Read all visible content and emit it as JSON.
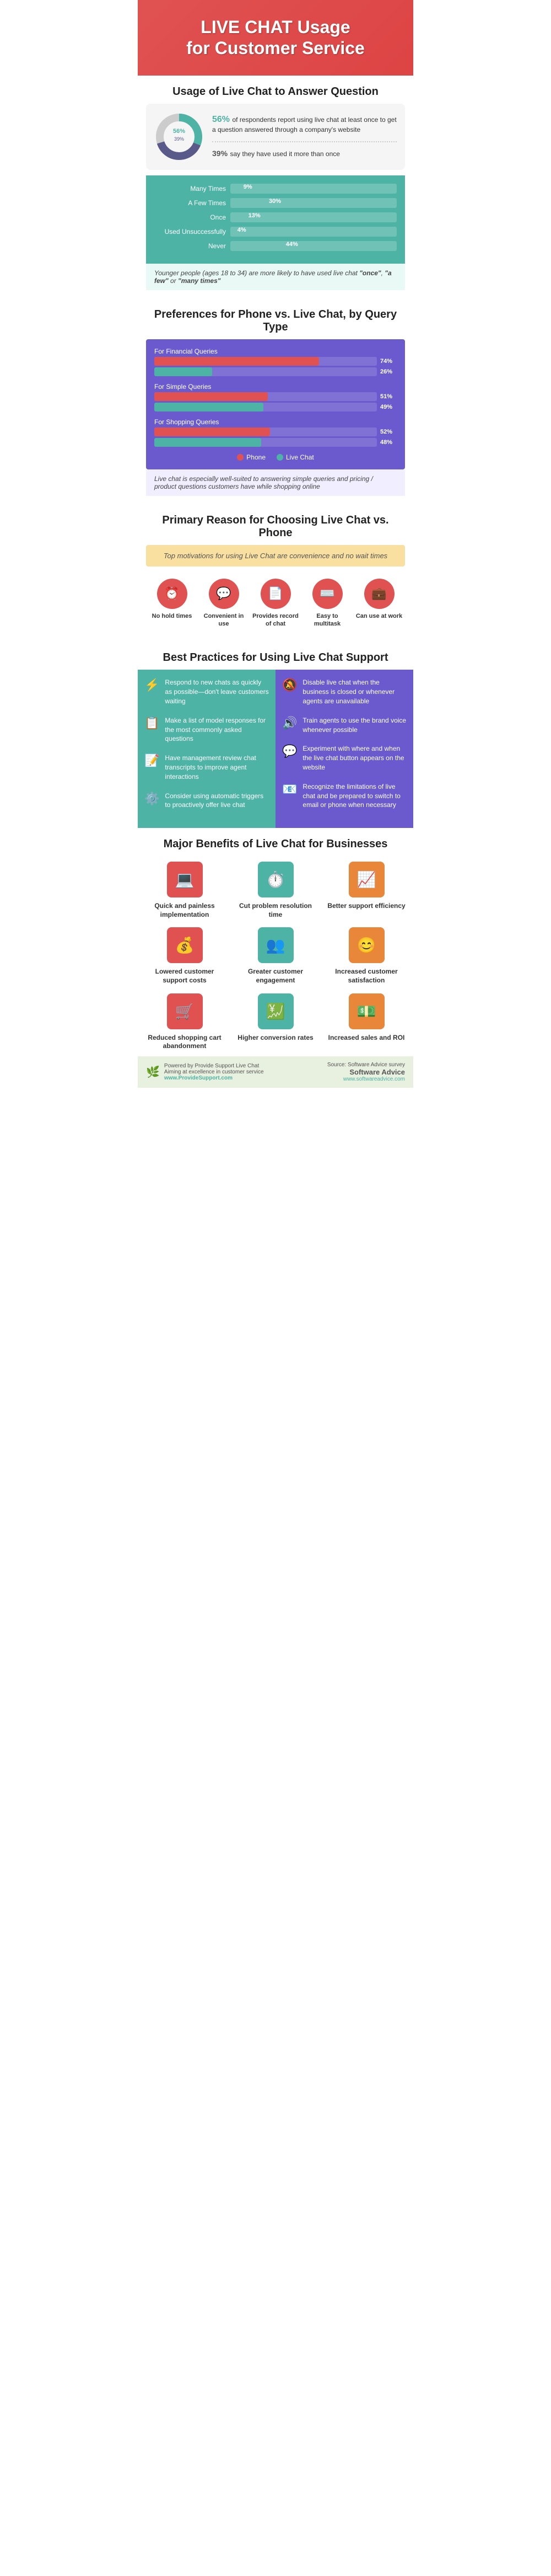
{
  "header": {
    "title_line1": "LIVE CHAT Usage",
    "title_line2": "for Customer Service"
  },
  "usage": {
    "section_title": "Usage of Live Chat to Answer Question",
    "stat1_pct": "56%",
    "stat1_text": "of respondents report using live chat at least once to get a question answered through a company's website",
    "stat2_pct": "39%",
    "stat2_text": "say they have used it more than once",
    "donut_56": 56,
    "donut_39": 39,
    "bars": [
      {
        "label": "Many Times",
        "value": 9,
        "display": "9%"
      },
      {
        "label": "A Few Times",
        "value": 30,
        "display": "30%"
      },
      {
        "label": "Once",
        "value": 13,
        "display": "13%"
      },
      {
        "label": "Used Unsuccessfully",
        "value": 4,
        "display": "4%"
      },
      {
        "label": "Never",
        "value": 44,
        "display": "44%"
      }
    ],
    "note": "Younger people (ages 18 to 34) are more likely to have used live chat \"once\", \"a few\" or \"many times\""
  },
  "preferences": {
    "section_title": "Preferences for Phone vs. Live Chat, by Query Type",
    "rows": [
      {
        "label": "For Financial Queries",
        "phone": 74,
        "livechat": 26,
        "phone_pct": "74%",
        "livechat_pct": "26%"
      },
      {
        "label": "For Simple Queries",
        "phone": 51,
        "livechat": 49,
        "phone_pct": "51%",
        "livechat_pct": "49%"
      },
      {
        "label": "For Shopping Queries",
        "phone": 52,
        "livechat": 48,
        "phone_pct": "52%",
        "livechat_pct": "48%"
      }
    ],
    "legend_phone": "Phone",
    "legend_livechat": "Live Chat",
    "note": "Live chat is especially well-suited to answering simple queries and pricing / product questions customers have while shopping online"
  },
  "reasons": {
    "section_title": "Primary Reason for Choosing Live Chat vs. Phone",
    "box_text": "Top motivations for using Live Chat are convenience and no wait times",
    "items": [
      {
        "label": "No hold times",
        "icon": "⏰"
      },
      {
        "label": "Convenient in use",
        "icon": "💬"
      },
      {
        "label": "Provides record of chat",
        "icon": "📄"
      },
      {
        "label": "Easy to multitask",
        "icon": "⌨️"
      },
      {
        "label": "Can use at work",
        "icon": "💼"
      }
    ]
  },
  "best_practices": {
    "section_title": "Best Practices for Using Live Chat Support",
    "left": [
      {
        "icon": "⚡",
        "text": "Respond to new chats as quickly as possible—don't leave customers waiting"
      },
      {
        "icon": "📋",
        "text": "Make a list of model responses for the most commonly asked questions"
      },
      {
        "icon": "📝",
        "text": "Have management review chat transcripts to improve agent interactions"
      },
      {
        "icon": "⚙️",
        "text": "Consider using automatic triggers to proactively offer live chat"
      }
    ],
    "right": [
      {
        "icon": "🔕",
        "text": "Disable live chat when the business is closed or whenever agents are unavailable"
      },
      {
        "icon": "🔊",
        "text": "Train agents to use the brand voice whenever possible"
      },
      {
        "icon": "💬",
        "text": "Experiment with where and when the live chat button appears on the website"
      },
      {
        "icon": "📧",
        "text": "Recognize the limitations of live chat and be prepared to switch to email or phone when necessary"
      }
    ]
  },
  "benefits": {
    "section_title": "Major Benefits of Live Chat for Businesses",
    "items": [
      {
        "icon": "💻",
        "label": "Quick and painless implementation",
        "color": "red"
      },
      {
        "icon": "⏱️",
        "label": "Cut problem resolution time",
        "color": "teal"
      },
      {
        "icon": "📈",
        "label": "Better support efficiency",
        "color": "orange"
      },
      {
        "icon": "💰",
        "label": "Lowered customer support costs",
        "color": "red"
      },
      {
        "icon": "👥",
        "label": "Greater customer engagement",
        "color": "teal"
      },
      {
        "icon": "😊",
        "label": "Increased customer satisfaction",
        "color": "orange"
      },
      {
        "icon": "🛒",
        "label": "Reduced shopping cart abandonment",
        "color": "red"
      },
      {
        "icon": "💹",
        "label": "Higher conversion rates",
        "color": "teal"
      },
      {
        "icon": "💵",
        "label": "Increased sales and ROI",
        "color": "orange"
      }
    ]
  },
  "footer": {
    "left_line1": "Powered by Provide Support Live Chat",
    "left_line2": "Aiming at excellence in customer service",
    "left_url": "www.ProvideSupport.com",
    "right_line1": "Source: Software Advice survey",
    "right_brand": "Software Advice",
    "right_url": "www.softwareadvice.com"
  }
}
